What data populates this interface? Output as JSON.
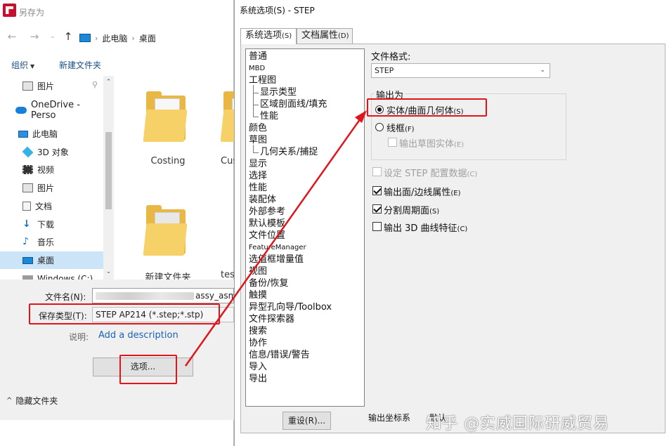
{
  "save_as": {
    "title": "另存为",
    "breadcrumb": [
      "此电脑",
      "桌面"
    ],
    "toolbar": {
      "organize": "组织",
      "new_folder": "新建文件夹"
    },
    "sidebar": [
      {
        "label": "图片",
        "icon": "pictures-icon",
        "pinned": true
      },
      {
        "label": "OneDrive - Perso",
        "icon": "onedrive-icon"
      },
      {
        "label": "此电脑",
        "icon": "computer-icon"
      },
      {
        "label": "3D 对象",
        "icon": "3d-objects-icon"
      },
      {
        "label": "视频",
        "icon": "video-icon"
      },
      {
        "label": "图片",
        "icon": "pictures-icon"
      },
      {
        "label": "文档",
        "icon": "documents-icon"
      },
      {
        "label": "下载",
        "icon": "download-icon"
      },
      {
        "label": "音乐",
        "icon": "music-icon"
      },
      {
        "label": "桌面",
        "icon": "desktop-icon",
        "selected": true
      },
      {
        "label": "Windows (C:)",
        "icon": "drive-icon"
      }
    ],
    "files": [
      {
        "name": "Costing"
      },
      {
        "name": "Cus"
      },
      {
        "name": "新建文件夹"
      },
      {
        "name": "tes"
      }
    ],
    "filename_label": "文件名(N):",
    "filename_value": "assy_asm.STEP",
    "filetype_label": "保存类型(T):",
    "filetype_value": "STEP AP214 (*.step;*.stp)",
    "description_label": "说明:",
    "description_link": "Add a description",
    "options_button": "选项...",
    "hide_folders": "隐藏文件夹"
  },
  "system_options": {
    "title": "系统选项(S) - STEP",
    "tabs": [
      {
        "label": "系统选项",
        "hotkey": "(S)",
        "active": true
      },
      {
        "label": "文档属性",
        "hotkey": "(D)",
        "active": false
      }
    ],
    "tree": [
      {
        "label": "普通"
      },
      {
        "label": "MBD",
        "small": true
      },
      {
        "label": "工程图"
      },
      {
        "label": "显示类型",
        "child": true
      },
      {
        "label": "区域剖面线/填充",
        "child": true
      },
      {
        "label": "性能",
        "child": true
      },
      {
        "label": "颜色"
      },
      {
        "label": "草图"
      },
      {
        "label": "几何关系/捕捉",
        "child": true
      },
      {
        "label": "显示"
      },
      {
        "label": "选择"
      },
      {
        "label": "性能"
      },
      {
        "label": "装配体"
      },
      {
        "label": "外部参考"
      },
      {
        "label": "默认模板"
      },
      {
        "label": "文件位置"
      },
      {
        "label": "FeatureManager",
        "small": true
      },
      {
        "label": "选值框增量值"
      },
      {
        "label": "视图"
      },
      {
        "label": "备份/恢复"
      },
      {
        "label": "触摸"
      },
      {
        "label": "异型孔向导/Toolbox"
      },
      {
        "label": "文件探索器"
      },
      {
        "label": "搜索"
      },
      {
        "label": "协作"
      },
      {
        "label": "信息/错误/警告"
      },
      {
        "label": "导入"
      },
      {
        "label": "导出"
      }
    ],
    "file_format_label": "文件格式:",
    "file_format_value": "STEP",
    "output_as_label": "输出为",
    "radio_solid": {
      "label": "实体/曲面几何体",
      "hotkey": "(S)",
      "checked": true
    },
    "radio_wireframe": {
      "label": "线框",
      "hotkey": "(F)",
      "checked": false
    },
    "chk_export_sketch": {
      "label": "输出草图实体",
      "hotkey": "(E)",
      "checked": false,
      "disabled": true
    },
    "chk_step_config": {
      "label": "设定 STEP 配置数据",
      "hotkey": "(C)",
      "checked": false,
      "disabled": true
    },
    "chk_face_edge": {
      "label": "输出面/边线属性",
      "hotkey": "(E)",
      "checked": true
    },
    "chk_split_periodic": {
      "label": "分割周期面",
      "hotkey": "(S)",
      "checked": true
    },
    "chk_3d_curve": {
      "label": "输出 3D 曲线特征",
      "hotkey": "(C)",
      "checked": false
    },
    "reset_button": "重设(R)...",
    "output_coord_label": "输出坐标系",
    "output_coord_value": "默认"
  },
  "watermark": "知乎 @实威国际研威贸易",
  "colors": {
    "annotation_red": "#e1141a",
    "selection_blue": "#cce4f7",
    "folder_yellow": "#e9b844",
    "link_blue": "#1a63b5"
  }
}
